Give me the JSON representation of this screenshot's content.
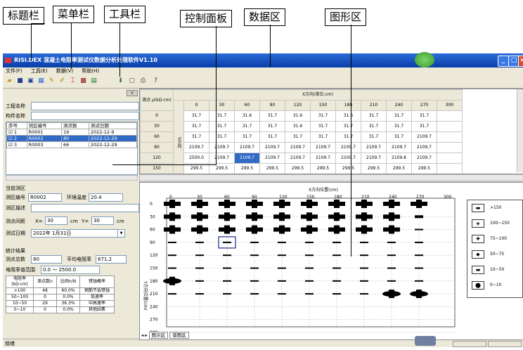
{
  "callouts": {
    "title_bar": "标题栏",
    "menu_bar": "菜单栏",
    "tool_bar": "工具栏",
    "control_panel": "控制面板",
    "data_area": "数据区",
    "graph_area": "图形区"
  },
  "window": {
    "title": "RISI.DEX  混凝土电阻率测试仪数据分析处理软件V1.10",
    "menu": [
      "文件(F)",
      "工具(E)",
      "数据(V)",
      "帮助(H)"
    ],
    "status": "就绪"
  },
  "control": {
    "project_label": "工程名称",
    "project_value": "",
    "member_label": "构件名称",
    "member_value": "",
    "list_headers": [
      "序号",
      "测区编号",
      "测点数",
      "测试日期"
    ],
    "list_rows": [
      [
        "1",
        "R0001",
        "19",
        "2022-12-9"
      ],
      [
        "2",
        "R0002",
        "80",
        "2022-12-29"
      ],
      [
        "3",
        "R0003",
        "66",
        "2022-12-29"
      ]
    ],
    "selected_row": 1,
    "current_section": "当前测区",
    "zone_id_label": "测区编号",
    "zone_id_value": "R0002",
    "temp_label": "环境温度",
    "temp_value": "20.4",
    "desc_label": "测区描述",
    "desc_value": "",
    "spacing_label": "测点间距",
    "x_label": "X=",
    "x_value": "30",
    "y_label": "Y=",
    "y_value": "30",
    "unit_cm1": "cm",
    "unit_cm2": "cm",
    "date_label": "测试日期",
    "date_value": "2022年 1月31日",
    "stats_section": "统计结果",
    "count_label": "测点总数",
    "count_value": "80",
    "avg_label": "平均电阻率",
    "avg_value": "671.2",
    "range_label": "电阻率值范围",
    "range_value": "0.0 ～ 2500.0",
    "stat_headers": [
      "电阻率(kΩ·cm)",
      "测点数n",
      "比例n/N",
      "锈蚀概率"
    ],
    "stat_rows": [
      [
        ">100",
        "48",
        "60.0%",
        "钢筋不会锈蚀"
      ],
      [
        "50~100",
        "0",
        "0.0%",
        "低速率"
      ],
      [
        "10~50",
        "29",
        "36.3%",
        "中高速率"
      ],
      [
        "0~10",
        "0",
        "0.0%",
        "其他因素"
      ]
    ]
  },
  "data_grid": {
    "corner": "测点 ρ(kΩ·cm)",
    "x_title": "X方向(单位:cm)",
    "y_title": "Y方向",
    "x_headers": [
      "0",
      "30",
      "60",
      "90",
      "120",
      "150",
      "180",
      "210",
      "240",
      "270",
      "300"
    ],
    "rows": [
      {
        "y": "0",
        "v": [
          "31.7",
          "31.7",
          "31.6",
          "31.7",
          "31.6",
          "31.7",
          "31.6",
          "31.7",
          "31.7",
          "31.7",
          ""
        ]
      },
      {
        "y": "30",
        "v": [
          "31.7",
          "31.7",
          "31.7",
          "31.7",
          "31.6",
          "31.7",
          "31.7",
          "31.7",
          "31.7",
          "31.7",
          ""
        ]
      },
      {
        "y": "60",
        "v": [
          "31.7",
          "31.7",
          "31.7",
          "31.7",
          "31.7",
          "31.7",
          "31.7",
          "31.7",
          "31.7",
          "2109.7",
          ""
        ]
      },
      {
        "y": "90",
        "v": [
          "2109.7",
          "2109.7",
          "2109.7",
          "2109.7",
          "2109.7",
          "2109.7",
          "2109.7",
          "2109.7",
          "2109.7",
          "2109.7",
          ""
        ]
      },
      {
        "y": "120",
        "v": [
          "2500.0",
          "2109.7",
          "2109.7",
          "2109.7",
          "2109.7",
          "2109.7",
          "2109.7",
          "2109.7",
          "2109.8",
          "2109.7",
          ""
        ]
      },
      {
        "y": "150",
        "v": [
          "299.5",
          "299.5",
          "299.5",
          "299.5",
          "299.5",
          "299.5",
          "299.5",
          "299.5",
          "299.5",
          "299.5",
          ""
        ]
      },
      {
        "y": "180",
        "v": [
          "0.0",
          "299.5",
          "299.5",
          "299.5",
          "299.5",
          "299.5",
          "299.5",
          "299.5",
          "299.5",
          "299.5",
          ""
        ]
      }
    ],
    "selected": {
      "row": 4,
      "col": 2
    }
  },
  "graph": {
    "x_title": "X方向位置(cm)",
    "y_title": "Y方向位置(cm)",
    "x_ticks": [
      "0",
      "30",
      "60",
      "90",
      "120",
      "150",
      "180",
      "210",
      "240",
      "270",
      "300"
    ],
    "y_ticks": [
      "0",
      "30",
      "60",
      "90",
      "120",
      "150",
      "180",
      "210",
      "240",
      "270",
      "300"
    ],
    "symbol_rows": [
      [
        "big",
        "big",
        "big",
        "big",
        "big",
        "big",
        "big",
        "big",
        "big",
        "big"
      ],
      [
        "big",
        "big",
        "big",
        "big",
        "big",
        "big",
        "big",
        "big",
        "big",
        "med"
      ],
      [
        "big",
        "big",
        "big",
        "big",
        "big",
        "big",
        "big",
        "big",
        "big",
        "small"
      ],
      [
        "small",
        "small",
        "small",
        "small",
        "small",
        "small",
        "small",
        "small",
        "small",
        "small"
      ],
      [
        "small",
        "small",
        "small",
        "small",
        "small",
        "small",
        "small",
        "small",
        "small",
        "small"
      ],
      [
        "small",
        "small",
        "small",
        "small",
        "small",
        "small",
        "small",
        "small",
        "small",
        "small"
      ],
      [
        "blob",
        "small",
        "small",
        "small",
        "small",
        "small",
        "small",
        "small",
        "small",
        "small"
      ],
      [
        "small",
        "small",
        "small",
        "small",
        "small",
        "small",
        "small",
        "small",
        "blob",
        "blob"
      ]
    ],
    "selected_point": {
      "row": 3,
      "col": 2
    },
    "legend": [
      ">150",
      "100~150",
      "75~100",
      "50~75",
      "10~50",
      "0~10"
    ],
    "tabs": [
      "图示区",
      "谱图区"
    ]
  },
  "colors": {
    "title_blue": "#0a3ea8",
    "selection": "#316ac5",
    "selected_point": "#1a2a8a"
  }
}
